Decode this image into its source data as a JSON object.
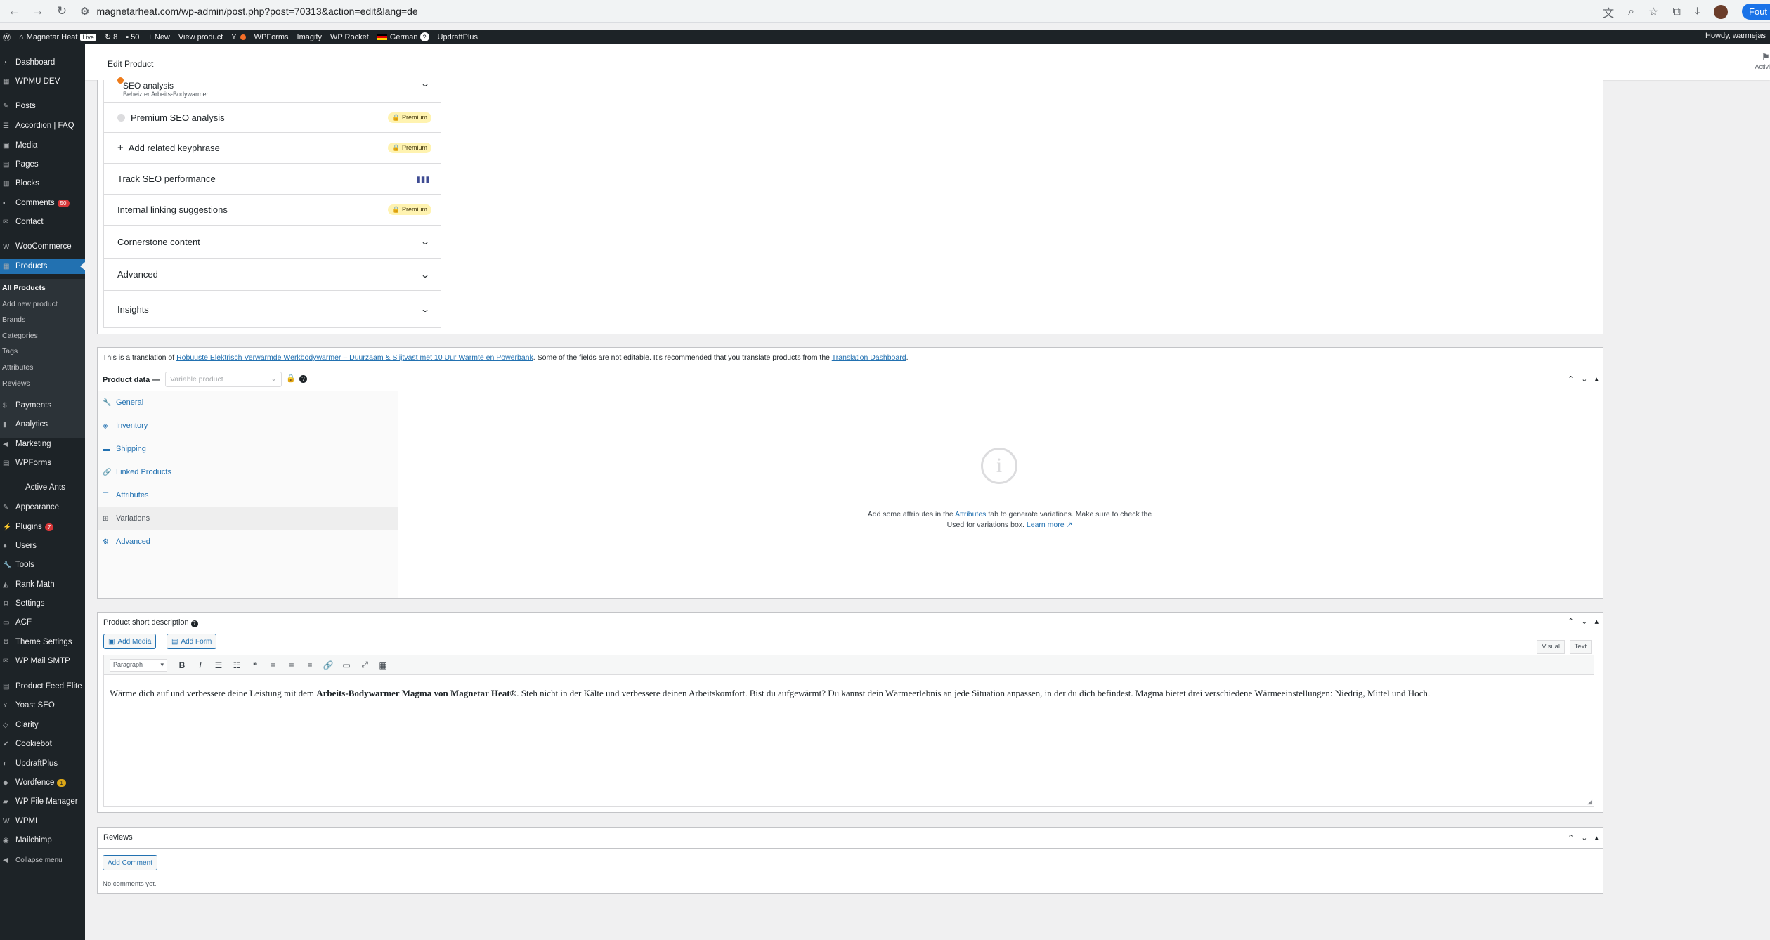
{
  "browser": {
    "url": "magnetarheat.com/wp-admin/post.php?post=70313&action=edit&lang=de",
    "profile_label": "Fout"
  },
  "adminbar": {
    "site_name": "Magnetar Heat",
    "live": "Live",
    "updates": "8",
    "comments": "50",
    "new": "New",
    "view_product": "View product",
    "wpforms": "WPForms",
    "imagify": "Imagify",
    "wp_rocket": "WP Rocket",
    "language": "German",
    "language_count": "?",
    "updraftplus": "UpdraftPlus",
    "howdy": "Howdy, warmejas"
  },
  "sidebar": {
    "items": [
      {
        "label": "Dashboard",
        "icon": "dashboard-icon"
      },
      {
        "label": "WPMU DEV",
        "icon": "wpmudev-icon"
      },
      {
        "label": "Posts",
        "icon": "pin-icon"
      },
      {
        "label": "Accordion | FAQ",
        "icon": "accordion-icon"
      },
      {
        "label": "Media",
        "icon": "media-icon"
      },
      {
        "label": "Pages",
        "icon": "pages-icon"
      },
      {
        "label": "Blocks",
        "icon": "blocks-icon"
      },
      {
        "label": "Comments",
        "icon": "comments-icon",
        "badge": "50"
      },
      {
        "label": "Contact",
        "icon": "contact-icon"
      },
      {
        "label": "WooCommerce",
        "icon": "woocommerce-icon"
      },
      {
        "label": "Products",
        "icon": "products-icon"
      },
      {
        "label": "Payments",
        "icon": "payments-icon"
      },
      {
        "label": "Analytics",
        "icon": "analytics-icon"
      },
      {
        "label": "Marketing",
        "icon": "marketing-icon"
      },
      {
        "label": "WPForms",
        "icon": "wpforms-icon"
      },
      {
        "label": "Active Ants",
        "icon": ""
      },
      {
        "label": "Appearance",
        "icon": "appearance-icon"
      },
      {
        "label": "Plugins",
        "icon": "plugins-icon",
        "badge": "7"
      },
      {
        "label": "Users",
        "icon": "users-icon"
      },
      {
        "label": "Tools",
        "icon": "tools-icon"
      },
      {
        "label": "Rank Math",
        "icon": "rankmath-icon"
      },
      {
        "label": "Settings",
        "icon": "settings-icon"
      },
      {
        "label": "ACF",
        "icon": "acf-icon"
      },
      {
        "label": "Theme Settings",
        "icon": "gear-icon"
      },
      {
        "label": "WP Mail SMTP",
        "icon": "mail-icon"
      },
      {
        "label": "Product Feed Elite",
        "icon": "feed-icon"
      },
      {
        "label": "Yoast SEO",
        "icon": "yoast-icon"
      },
      {
        "label": "Clarity",
        "icon": "clarity-icon"
      },
      {
        "label": "Cookiebot",
        "icon": "cookiebot-icon"
      },
      {
        "label": "UpdraftPlus",
        "icon": "updraft-icon"
      },
      {
        "label": "Wordfence",
        "icon": "wordfence-icon",
        "badge": "1"
      },
      {
        "label": "WP File Manager",
        "icon": "folder-icon"
      },
      {
        "label": "WPML",
        "icon": "wpml-icon"
      },
      {
        "label": "Mailchimp",
        "icon": "mailchimp-icon"
      },
      {
        "label": "Collapse menu",
        "icon": "collapse-icon"
      }
    ],
    "products_submenu": [
      "All Products",
      "Add new product",
      "Brands",
      "Categories",
      "Tags",
      "Attributes",
      "Reviews"
    ]
  },
  "header": {
    "title": "Edit Product",
    "activity": "Activi"
  },
  "yoast": {
    "seo_analysis": "SEO analysis",
    "seo_keyphrase": "Beheizter Arbeits-Bodywarmer",
    "premium_seo": "Premium SEO analysis",
    "related_keyphrase": "Add related keyphrase",
    "track_seo": "Track SEO performance",
    "internal_linking": "Internal linking suggestions",
    "cornerstone": "Cornerstone content",
    "advanced": "Advanced",
    "insights": "Insights",
    "premium_badge": "Premium"
  },
  "product_data": {
    "note_prefix": "This is a translation of",
    "note_link": "Robuuste Elektrisch Verwarmde Werkbodywarmer – Duurzaam & Slijtvast met 10 Uur Warmte en Powerbank",
    "note_middle": ". Some of the fields are not editable. It's recommended that you translate products from the",
    "note_dashboard": "Translation Dashboard",
    "note_end": ".",
    "label": "Product data —",
    "type_value": "Variable product",
    "tabs": [
      "General",
      "Inventory",
      "Shipping",
      "Linked Products",
      "Attributes",
      "Variations",
      "Advanced"
    ],
    "empty_line1_a": "Add some attributes in the",
    "empty_line1_link": "Attributes",
    "empty_line1_b": "tab to generate variations. Make sure to check the",
    "empty_line2": "Used for variations box.",
    "learn_more": "Learn more"
  },
  "short_description": {
    "title": "Product short description",
    "add_media": "Add Media",
    "add_form": "Add Form",
    "visual": "Visual",
    "text": "Text",
    "format": "Paragraph",
    "content_a": "Wärme dich auf und verbessere deine Leistung mit dem",
    "content_bold": "Arbeits-Bodywarmer Magma von Magnetar Heat®",
    "content_b": ". Steh nicht in der Kälte und verbessere deinen Arbeitskomfort. Bist du aufgewärmt? Du kannst dein Wärmeerlebnis an jede Situation anpassen, in der du dich befindest. Magma bietet drei verschiedene Wärmeeinstellungen: Niedrig, Mittel und Hoch."
  },
  "reviews": {
    "title": "Reviews",
    "add_comment": "Add Comment",
    "no_comments": "No comments yet."
  }
}
